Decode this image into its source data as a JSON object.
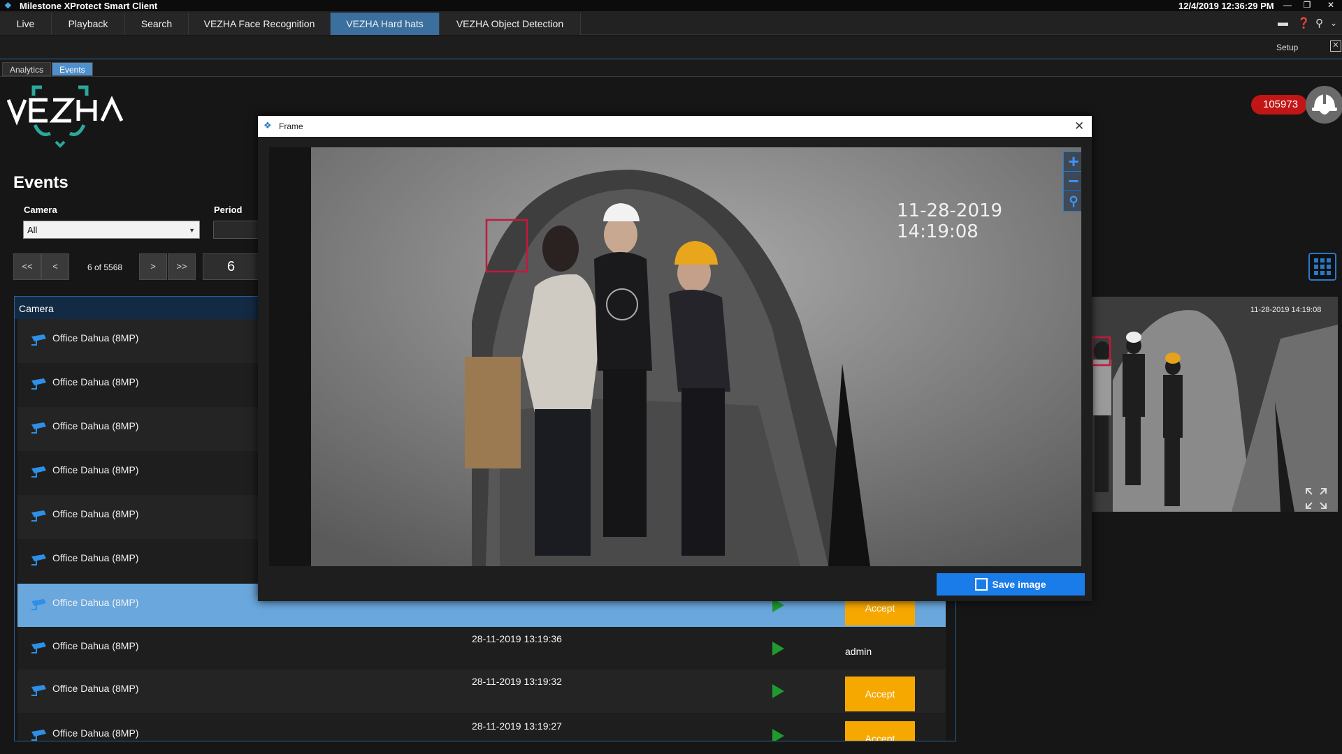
{
  "titlebar": {
    "app_title": "Milestone XProtect Smart Client",
    "datetime": "12/4/2019 12:36:29 PM"
  },
  "main_tabs": [
    {
      "label": "Live"
    },
    {
      "label": "Playback"
    },
    {
      "label": "Search"
    },
    {
      "label": "VEZHA Face Recognition"
    },
    {
      "label": "VEZHA Hard hats",
      "active": true
    },
    {
      "label": "VEZHA Object Detection"
    }
  ],
  "setup_label": "Setup",
  "sub_tabs": [
    {
      "label": "Analytics"
    },
    {
      "label": "Events",
      "active": true
    }
  ],
  "logo_text": "VEZHA",
  "events_title": "Events",
  "filters": {
    "camera_label": "Camera",
    "camera_value": "All",
    "period_label": "Period"
  },
  "pagination": {
    "first": "<<",
    "prev": "<",
    "info": "6 of 5568",
    "next": ">",
    "last": ">>",
    "page": "6"
  },
  "table": {
    "header_camera": "Camera",
    "rows": [
      {
        "camera": "Office Dahua (8MP)",
        "time": "",
        "action": ""
      },
      {
        "camera": "Office Dahua (8MP)",
        "time": "",
        "action": ""
      },
      {
        "camera": "Office Dahua (8MP)",
        "time": "",
        "action": ""
      },
      {
        "camera": "Office Dahua (8MP)",
        "time": "",
        "action": ""
      },
      {
        "camera": "Office Dahua (8MP)",
        "time": "",
        "action": ""
      },
      {
        "camera": "Office Dahua (8MP)",
        "time": "",
        "action": ""
      },
      {
        "camera": "Office Dahua (8MP)",
        "time": "",
        "action": "Accept",
        "selected": true
      },
      {
        "camera": "Office Dahua (8MP)",
        "time": "28-11-2019 13:19:36",
        "action": "admin"
      },
      {
        "camera": "Office Dahua (8MP)",
        "time": "28-11-2019 13:19:32",
        "action": "Accept"
      },
      {
        "camera": "Office Dahua (8MP)",
        "time": "28-11-2019 13:19:27",
        "action": "Accept"
      }
    ]
  },
  "alert_count": "105973",
  "thumbnail_timestamp": "11-28-2019 14:19:08",
  "modal": {
    "title": "Frame",
    "frame_timestamp": "11-28-2019 14:19:08",
    "save_label": "Save image"
  },
  "colors": {
    "accent": "#1a7ce8",
    "active_tab": "#3a6f9e",
    "accept": "#f7a800",
    "alert": "#c21515",
    "play": "#1f9a2e"
  }
}
